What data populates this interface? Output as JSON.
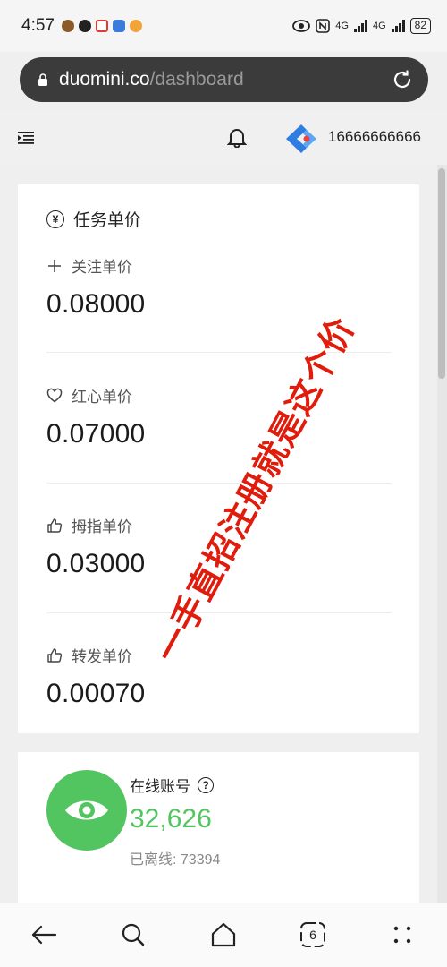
{
  "status_bar": {
    "time": "4:57",
    "network_1": "4G",
    "network_2": "4G",
    "battery": "82"
  },
  "browser": {
    "url_host": "duomini.co",
    "url_path": "/dashboard",
    "tab_count": "6"
  },
  "header": {
    "phone": "16666666666"
  },
  "price_card": {
    "title": "任务单价",
    "items": [
      {
        "label": "关注单价",
        "value": "0.08000",
        "icon": "plus-icon"
      },
      {
        "label": "红心单价",
        "value": "0.07000",
        "icon": "heart-icon"
      },
      {
        "label": "拇指单价",
        "value": "0.03000",
        "icon": "thumbs-up-icon"
      },
      {
        "label": "转发单价",
        "value": "0.00070",
        "icon": "thumbs-up-icon"
      }
    ]
  },
  "watermark": "一手直招注册就是这个价",
  "online_card": {
    "title": "在线账号",
    "count": "32,626",
    "offline": "已离线: 73394"
  },
  "colors": {
    "accent_green": "#52c460",
    "watermark_red": "#e01c0c",
    "address_bar": "#3b3b3b"
  }
}
